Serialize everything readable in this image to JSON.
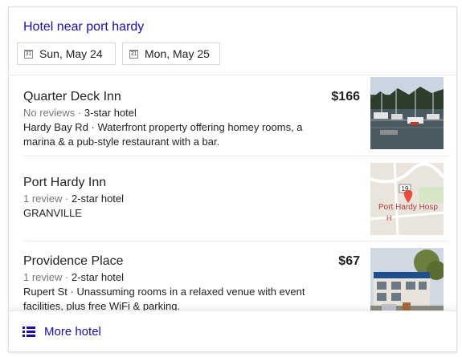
{
  "header": {
    "title": "Hotel near port hardy",
    "checkin": "Sun, May 24",
    "checkout": "Mon, May 25",
    "calendar_icon_text": "31"
  },
  "hotels": [
    {
      "name": "Quarter Deck Inn",
      "reviews": "No reviews",
      "stars": "3-star hotel",
      "description": "Hardy Bay Rd · Waterfront property offering homey rooms, a marina & a pub-style restaurant with a bar.",
      "price": "$166",
      "thumb_icon": "marina-photo"
    },
    {
      "name": "Port Hardy Inn",
      "reviews": "1 review",
      "stars": "2-star hotel",
      "description": "GRANVILLE",
      "price": "",
      "thumb_icon": "map-thumbnail",
      "map_label": "Port Hardy Hosp",
      "map_route": "19",
      "map_marker": "H"
    },
    {
      "name": "Providence Place",
      "reviews": "1 review",
      "stars": "2-star hotel",
      "description": "Rupert St · Unassuming rooms in a relaxed venue with event facilities, plus free WiFi & parking.",
      "price": "$67",
      "thumb_icon": "hotel-building-photo"
    }
  ],
  "footer": {
    "label": "More hotel",
    "icon": "list-icon"
  },
  "colors": {
    "link": "#1a0dab",
    "text": "#222222",
    "muted": "#777777"
  }
}
